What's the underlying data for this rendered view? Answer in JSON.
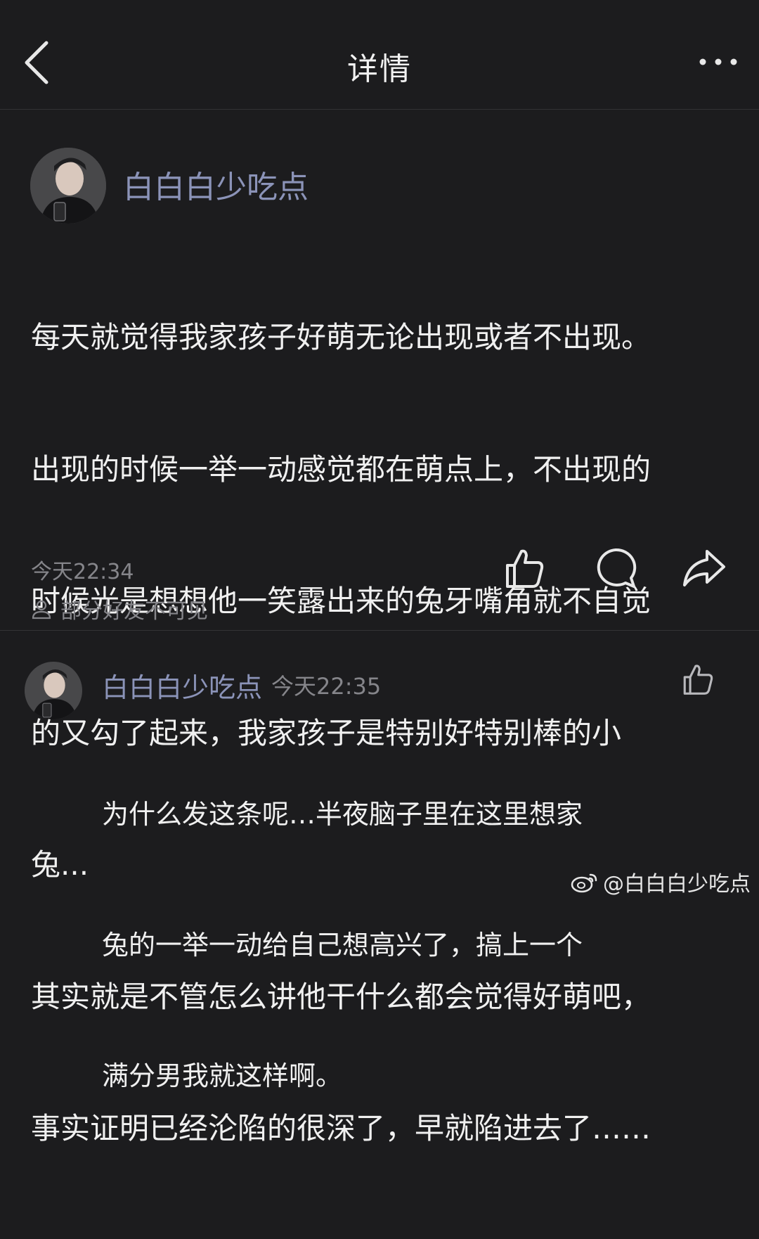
{
  "header": {
    "title": "详情",
    "back_icon": "chevron-left-icon",
    "more_icon": "more-horizontal-icon"
  },
  "post": {
    "username": "白白白少吃点",
    "body_lines": [
      "每天就觉得我家孩子好萌无论出现或者不出现。",
      "出现的时候一举一动感觉都在萌点上，不出现的",
      "时候光是想想他一笑露出来的兔牙嘴角就不自觉",
      "的又勾了起来，我家孩子是特别好特别棒的小",
      "兔...",
      "其实就是不管怎么讲他干什么都会觉得好萌吧，",
      "事实证明已经沦陷的很深了，早就陷进去了……"
    ],
    "time": "今天22:34",
    "visibility": "部分好友不可见",
    "actions": [
      "like-icon",
      "comment-icon",
      "share-icon"
    ]
  },
  "comment": {
    "username": "白白白少吃点",
    "time": "今天22:35",
    "body_lines": [
      "为什么发这条呢…半夜脑子里在这里想家",
      "兔的一举一动给自己想高兴了，搞上一个",
      "满分男我就这样啊。"
    ]
  },
  "watermark": {
    "text": "@白白白少吃点",
    "icon": "weibo-logo-icon"
  },
  "colors": {
    "background": "#1c1c1e",
    "username": "#8b93b8",
    "text": "#f0f0f0",
    "secondary": "#85858a"
  }
}
